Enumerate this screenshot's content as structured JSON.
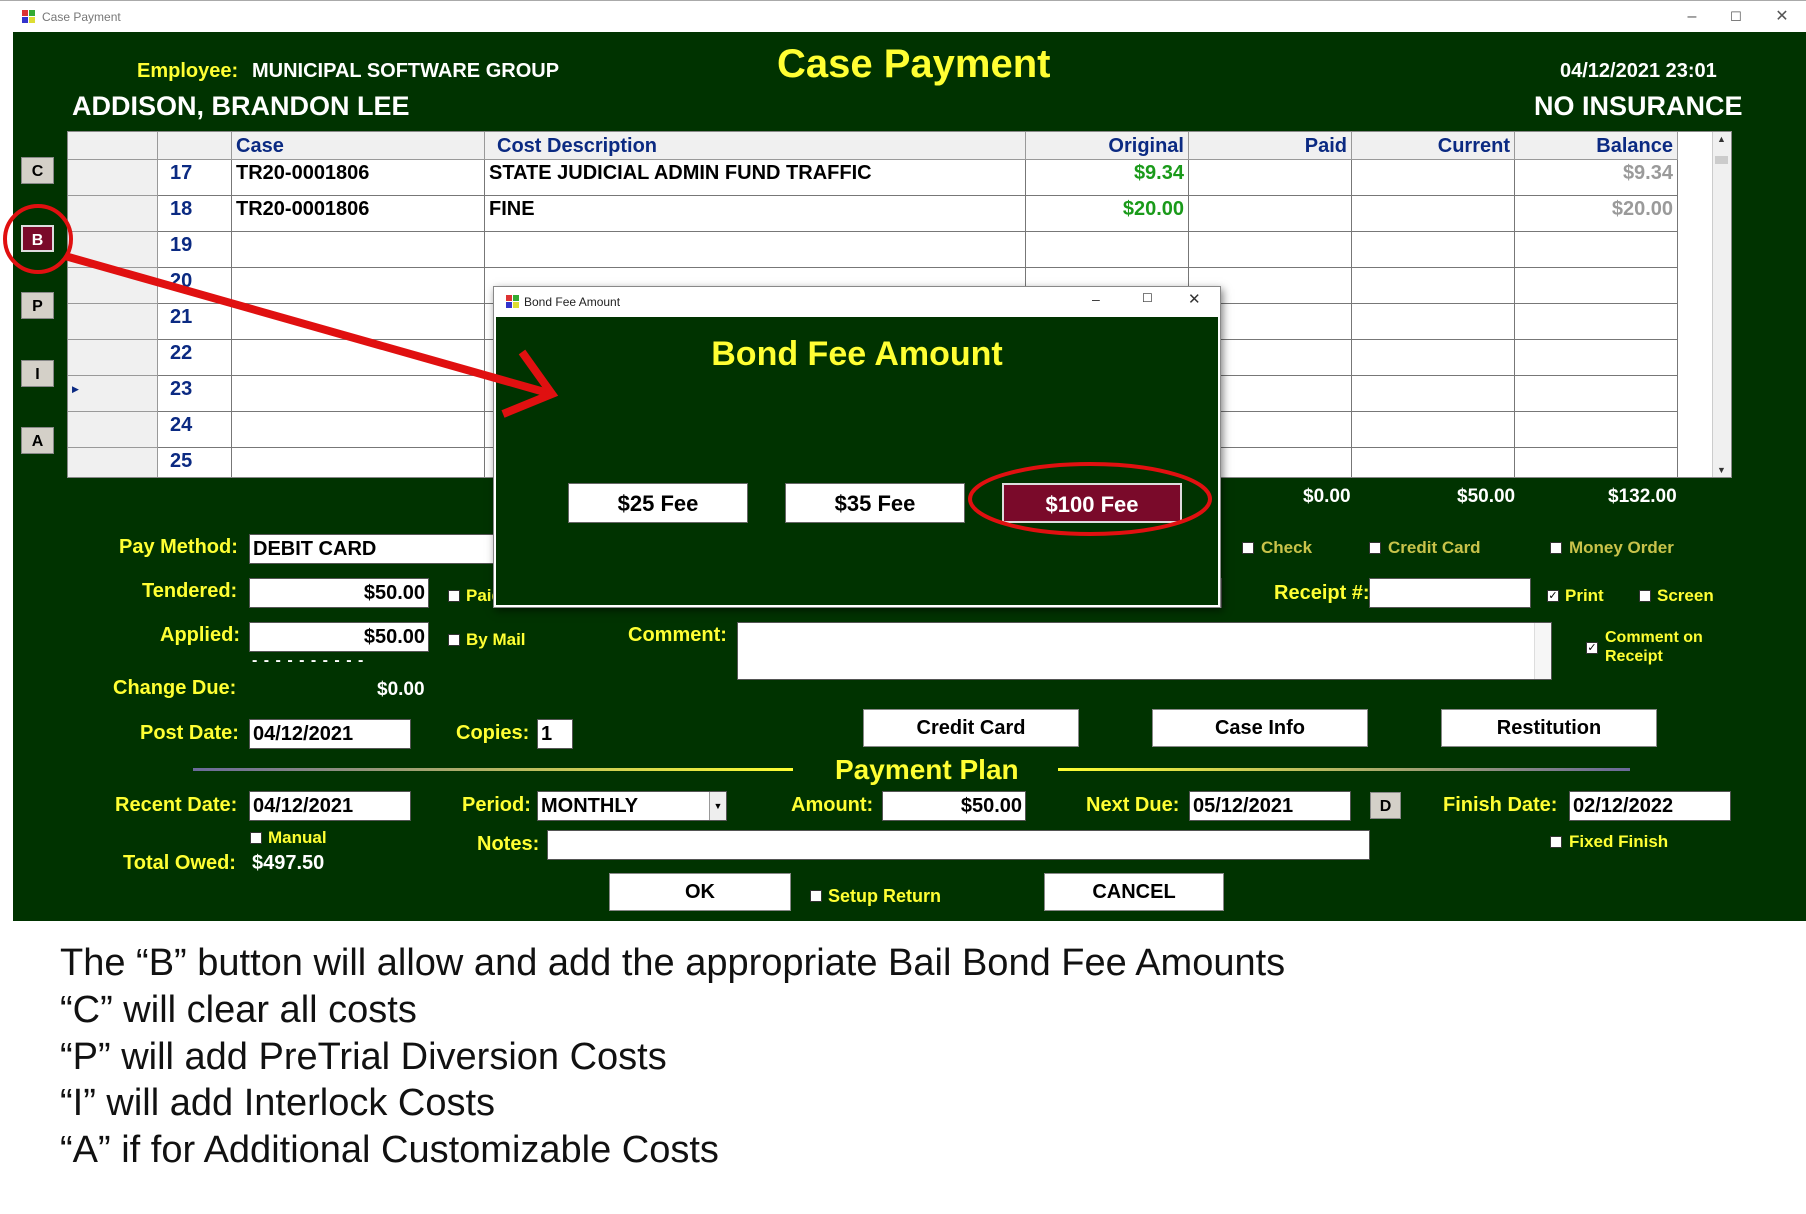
{
  "window": {
    "title": "Case Payment"
  },
  "header": {
    "employee_label": "Employee:",
    "employee_value": "MUNICIPAL SOFTWARE GROUP",
    "title": "Case Payment",
    "datetime": "04/12/2021 23:01",
    "defendant": "ADDISON, BRANDON LEE",
    "insurance": "NO INSURANCE"
  },
  "side_buttons": [
    "C",
    "B",
    "P",
    "I",
    "A"
  ],
  "grid": {
    "columns": [
      "Case",
      "Cost Description",
      "Original",
      "Paid",
      "Current",
      "Balance"
    ],
    "rows": [
      {
        "num": "17",
        "case": "TR20-0001806",
        "desc": "STATE JUDICIAL ADMIN FUND TRAFFIC",
        "original": "$9.34",
        "paid": "",
        "current": "",
        "balance": "$9.34"
      },
      {
        "num": "18",
        "case": "TR20-0001806",
        "desc": "FINE",
        "original": "$20.00",
        "paid": "",
        "current": "",
        "balance": "$20.00"
      },
      {
        "num": "19",
        "case": "",
        "desc": "",
        "original": "",
        "paid": "",
        "current": "",
        "balance": ""
      },
      {
        "num": "20",
        "case": "",
        "desc": "",
        "original": "",
        "paid": "",
        "current": "",
        "balance": ""
      },
      {
        "num": "21",
        "case": "",
        "desc": "",
        "original": "",
        "paid": "",
        "current": "",
        "balance": ""
      },
      {
        "num": "22",
        "case": "",
        "desc": "",
        "original": "",
        "paid": "",
        "current": "",
        "balance": ""
      },
      {
        "num": "23",
        "case": "",
        "desc": "",
        "original": "",
        "paid": "",
        "current": "",
        "balance": ""
      },
      {
        "num": "24",
        "case": "",
        "desc": "",
        "original": "",
        "paid": "",
        "current": "",
        "balance": ""
      },
      {
        "num": "25",
        "case": "",
        "desc": "",
        "original": "",
        "paid": "",
        "current": "",
        "balance": ""
      }
    ],
    "totals": {
      "paid": "$0.00",
      "current": "$50.00",
      "balance": "$132.00"
    }
  },
  "payment": {
    "pay_method_label": "Pay Method:",
    "pay_method_value": "DEBIT CARD",
    "tendered_label": "Tendered:",
    "tendered_value": "$50.00",
    "applied_label": "Applied:",
    "applied_value": "$50.00",
    "dashes": "- - - - - - - - - -",
    "change_due_label": "Change Due:",
    "change_due_value": "$0.00",
    "paid_chk_label": "Paid",
    "by_mail_label": "By Mail",
    "comment_label": "Comment:",
    "check_label": "Check",
    "credit_card_chk_label": "Credit Card",
    "money_order_label": "Money Order",
    "receipt_label": "Receipt #:",
    "print_label": "Print",
    "screen_label": "Screen",
    "comment_on_receipt_label1": "Comment on",
    "comment_on_receipt_label2": "Receipt",
    "post_date_label": "Post Date:",
    "post_date_value": "04/12/2021",
    "copies_label": "Copies:",
    "copies_value": "1",
    "credit_card_button": "Credit Card",
    "case_info_button": "Case Info",
    "restitution_button": "Restitution"
  },
  "plan": {
    "title": "Payment Plan",
    "recent_date_label": "Recent Date:",
    "recent_date_value": "04/12/2021",
    "manual_label": "Manual",
    "total_owed_label": "Total Owed:",
    "total_owed_value": "$497.50",
    "period_label": "Period:",
    "period_value": "MONTHLY",
    "notes_label": "Notes:",
    "amount_label": "Amount:",
    "amount_value": "$50.00",
    "next_due_label": "Next Due:",
    "next_due_value": "05/12/2021",
    "d_button": "D",
    "finish_date_label": "Finish Date:",
    "finish_date_value": "02/12/2022",
    "fixed_finish_label": "Fixed Finish",
    "ok_button": "OK",
    "setup_return_label": "Setup Return",
    "cancel_button": "CANCEL"
  },
  "dialog": {
    "window_title": "Bond Fee Amount",
    "heading": "Bond Fee Amount",
    "fee_buttons": [
      "$25 Fee",
      "$35 Fee",
      "$100 Fee"
    ]
  },
  "notes": [
    "The “B” button will allow and add the appropriate Bail Bond Fee Amounts",
    "“C” will clear all costs",
    "“P” will add PreTrial Diversion Costs",
    " “I” will add Interlock Costs",
    " “A” if for Additional Customizable Costs"
  ],
  "colors": {
    "panel": "#003300",
    "accent_yellow": "#ffff33",
    "selected_button": "#7a0a2a",
    "annotation_red": "#e01010"
  }
}
